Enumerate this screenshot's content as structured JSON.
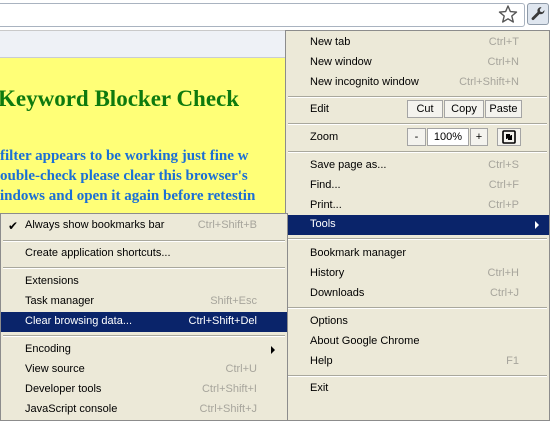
{
  "page": {
    "title": "Keyword Blocker Check",
    "lines": [
      "filter appears to be working just fine w",
      "ouble-check please clear this browser's",
      "indows and open it again before retestin"
    ]
  },
  "toolbar": {
    "bookmark_icon": "star-icon",
    "menu_icon": "wrench-icon"
  },
  "main_menu": {
    "new_tab": {
      "label": "New tab",
      "shortcut": "Ctrl+T"
    },
    "new_window": {
      "label": "New window",
      "shortcut": "Ctrl+N"
    },
    "new_incognito": {
      "label": "New incognito window",
      "shortcut": "Ctrl+Shift+N"
    },
    "edit": {
      "label": "Edit",
      "cut": "Cut",
      "copy": "Copy",
      "paste": "Paste"
    },
    "zoom": {
      "label": "Zoom",
      "minus": "-",
      "value": "100%",
      "plus": "+"
    },
    "save_page": {
      "label": "Save page as...",
      "shortcut": "Ctrl+S"
    },
    "find": {
      "label": "Find...",
      "shortcut": "Ctrl+F"
    },
    "print": {
      "label": "Print...",
      "shortcut": "Ctrl+P"
    },
    "tools": {
      "label": "Tools"
    },
    "bookmark_manager": {
      "label": "Bookmark manager"
    },
    "history": {
      "label": "History",
      "shortcut": "Ctrl+H"
    },
    "downloads": {
      "label": "Downloads",
      "shortcut": "Ctrl+J"
    },
    "options": {
      "label": "Options"
    },
    "about": {
      "label": "About Google Chrome"
    },
    "help": {
      "label": "Help",
      "shortcut": "F1"
    },
    "exit": {
      "label": "Exit"
    }
  },
  "tools_menu": {
    "show_bookmarks": {
      "label": "Always show bookmarks bar",
      "shortcut": "Ctrl+Shift+B",
      "checked": true
    },
    "app_shortcuts": {
      "label": "Create application shortcuts..."
    },
    "extensions": {
      "label": "Extensions"
    },
    "task_manager": {
      "label": "Task manager",
      "shortcut": "Shift+Esc"
    },
    "clear_data": {
      "label": "Clear browsing data...",
      "shortcut": "Ctrl+Shift+Del"
    },
    "encoding": {
      "label": "Encoding"
    },
    "view_source": {
      "label": "View source",
      "shortcut": "Ctrl+U"
    },
    "dev_tools": {
      "label": "Developer tools",
      "shortcut": "Ctrl+Shift+I"
    },
    "js_console": {
      "label": "JavaScript console",
      "shortcut": "Ctrl+Shift+J"
    }
  },
  "colors": {
    "selection": "#0a246a",
    "menu_bg": "#ece9d8",
    "page_bg": "#ffff77"
  }
}
